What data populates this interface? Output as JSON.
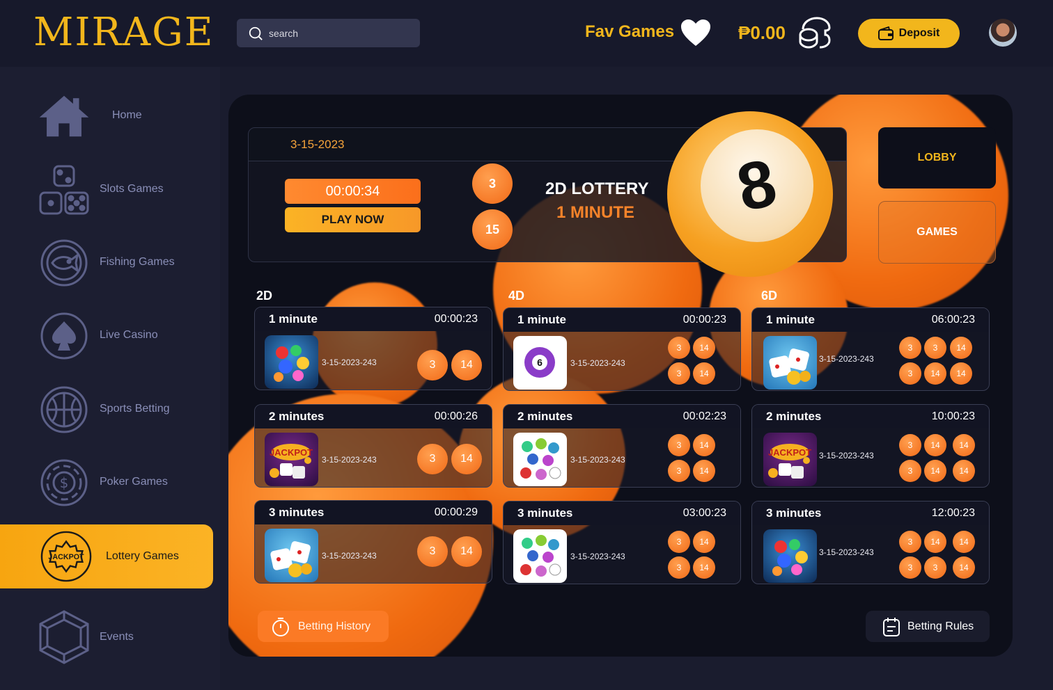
{
  "brand": {
    "logo": "MIRAGE"
  },
  "header": {
    "search_placeholder": "search",
    "fav_label": "Fav Games",
    "balance": "₱0.00",
    "deposit_label": "Deposit"
  },
  "sidebar": {
    "items": [
      {
        "label": "Home",
        "icon": "home-icon"
      },
      {
        "label": "Slots Games",
        "icon": "dice-icon"
      },
      {
        "label": "Fishing Games",
        "icon": "fish-icon"
      },
      {
        "label": "Live Casino",
        "icon": "spade-icon"
      },
      {
        "label": "Sports Betting",
        "icon": "basketball-icon"
      },
      {
        "label": "Poker Games",
        "icon": "poker-chip-icon"
      },
      {
        "label": "Lottery Games",
        "icon": "jackpot-icon",
        "active": true
      },
      {
        "label": "Events",
        "icon": "diamond-icon"
      }
    ]
  },
  "hero": {
    "date": "3-15-2023",
    "timer": "00:00:34",
    "play_label": "PLAY NOW",
    "balls": [
      "3",
      "15"
    ],
    "title": "2D LOTTERY",
    "subtitle": "1 MINUTE",
    "big_ball": "8"
  },
  "nav": {
    "lobby": "LOBBY",
    "games": "GAMES",
    "jackpot_badge": "JACKPOT"
  },
  "columns": [
    {
      "title": "2D",
      "cards": [
        {
          "name": "1 minute",
          "time": "00:00:23",
          "date": "3-15-2023-243",
          "balls": [
            "3",
            "14"
          ]
        },
        {
          "name": "2 minutes",
          "time": "00:00:26",
          "date": "3-15-2023-243",
          "balls": [
            "3",
            "14"
          ]
        },
        {
          "name": "3 minutes",
          "time": "00:00:29",
          "date": "3-15-2023-243",
          "balls": [
            "3",
            "14"
          ]
        }
      ]
    },
    {
      "title": "4D",
      "cards": [
        {
          "name": "1 minute",
          "time": "00:00:23",
          "date": "3-15-2023-243",
          "balls": [
            "3",
            "14",
            "3",
            "14"
          ]
        },
        {
          "name": "2 minutes",
          "time": "00:02:23",
          "date": "3-15-2023-243",
          "balls": [
            "3",
            "14",
            "3",
            "14"
          ]
        },
        {
          "name": "3 minutes",
          "time": "03:00:23",
          "date": "3-15-2023-243",
          "balls": [
            "3",
            "14",
            "3",
            "14"
          ]
        }
      ]
    },
    {
      "title": "6D",
      "cards": [
        {
          "name": "1 minute",
          "time": "06:00:23",
          "date": "3-15-2023-243",
          "balls": [
            "3",
            "3",
            "14",
            "3",
            "14",
            "14"
          ]
        },
        {
          "name": "2 minutes",
          "time": "10:00:23",
          "date": "3-15-2023-243",
          "balls": [
            "3",
            "14",
            "14",
            "3",
            "14",
            "14"
          ]
        },
        {
          "name": "3 minutes",
          "time": "12:00:23",
          "date": "3-15-2023-243",
          "balls": [
            "3",
            "14",
            "14",
            "3",
            "3",
            "14"
          ]
        }
      ]
    }
  ],
  "footer": {
    "history_label": "Betting History",
    "rules_label": "Betting Rules"
  },
  "colors": {
    "accent": "#f2b61c",
    "orange": "#f26a17",
    "bg": "#1a1c2e"
  }
}
